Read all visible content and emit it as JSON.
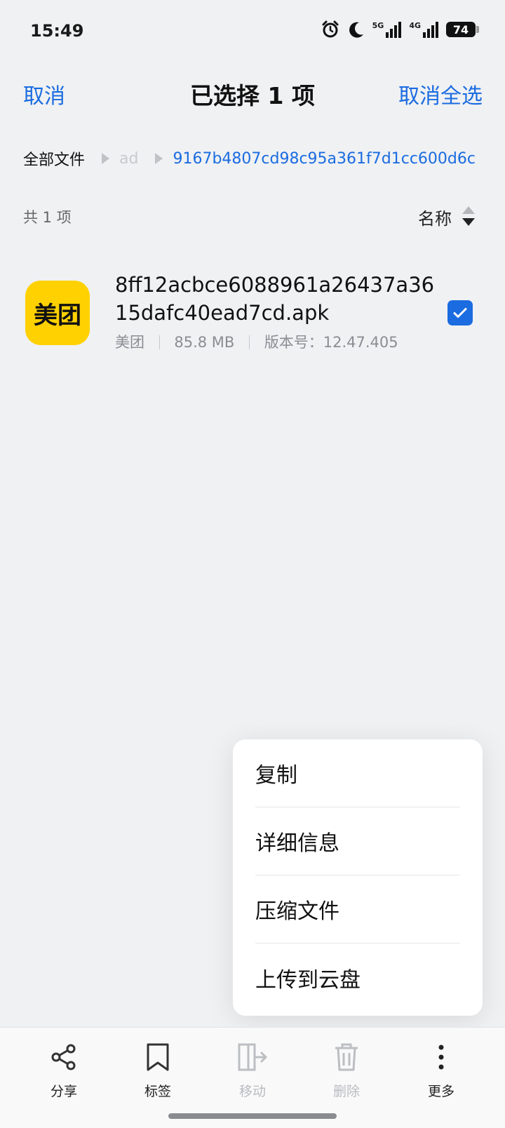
{
  "status_bar": {
    "time": "15:49",
    "signal1_label": "5G",
    "signal2_label": "4G",
    "battery": "74",
    "icons": [
      "alarm-icon",
      "moon-icon",
      "signal-5g-icon",
      "signal-4g-icon",
      "battery-icon"
    ]
  },
  "header": {
    "cancel": "取消",
    "title": "已选择 1 项",
    "deselect_all": "取消全选"
  },
  "breadcrumb": {
    "root": "全部文件",
    "middle": "ad",
    "current": "9167b4807cd98c95a361f7d1cc600d6c"
  },
  "list": {
    "count": "共 1 项",
    "sort_label": "名称",
    "files": [
      {
        "icon_text": "美团",
        "name": "8ff12acbce6088961a26437a3615dafc40ead7cd.apk",
        "app": "美团",
        "size": "85.8 MB",
        "version": "版本号：12.47.405",
        "selected": true
      }
    ]
  },
  "popup_menu": {
    "items": [
      "复制",
      "详细信息",
      "压缩文件",
      "上传到云盘"
    ]
  },
  "toolbar": {
    "share": "分享",
    "tag": "标签",
    "move": "移动",
    "delete": "删除",
    "more": "更多"
  },
  "colors": {
    "accent": "#1a6ce0",
    "app_icon_bg": "#ffd100",
    "background": "#f0f1f3"
  }
}
